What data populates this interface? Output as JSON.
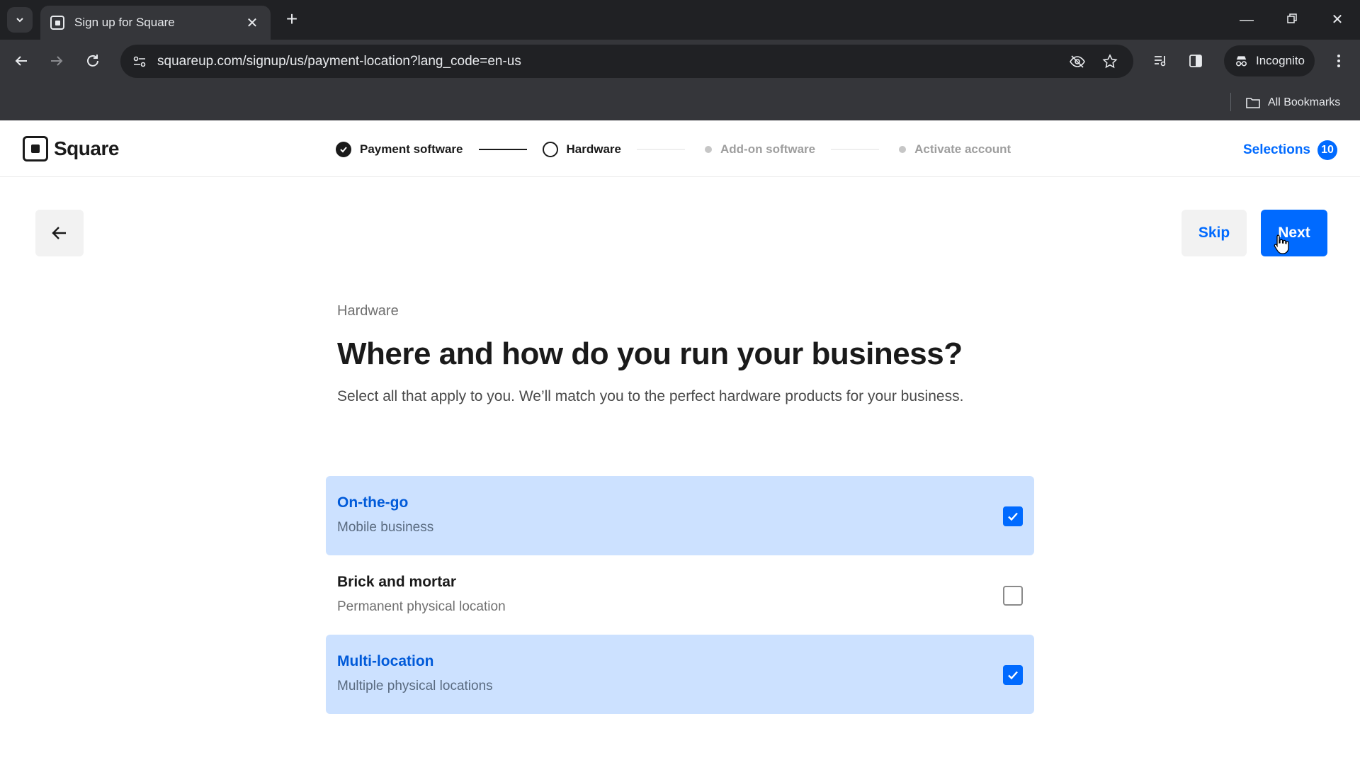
{
  "browser": {
    "tab_title": "Sign up for Square",
    "url": "squareup.com/signup/us/payment-location?lang_code=en-us",
    "incognito_label": "Incognito",
    "all_bookmarks_label": "All Bookmarks"
  },
  "header": {
    "logo_text": "Square",
    "steps": [
      {
        "label": "Payment software",
        "state": "done"
      },
      {
        "label": "Hardware",
        "state": "current"
      },
      {
        "label": "Add-on software",
        "state": "upcoming"
      },
      {
        "label": "Activate account",
        "state": "upcoming"
      }
    ],
    "selections_label": "Selections",
    "selections_count": "10"
  },
  "actions": {
    "skip_label": "Skip",
    "next_label": "Next"
  },
  "main": {
    "eyebrow": "Hardware",
    "headline": "Where and how do you run your business?",
    "subtitle": "Select all that apply to you. We’ll match you to the perfect hardware products for your business.",
    "options": [
      {
        "title": "On-the-go",
        "description": "Mobile business",
        "checked": true
      },
      {
        "title": "Brick and mortar",
        "description": "Permanent physical location",
        "checked": false
      },
      {
        "title": "Multi-location",
        "description": "Multiple physical locations",
        "checked": true
      }
    ]
  },
  "colors": {
    "brand_blue": "#006aff",
    "selected_bg": "#cce1ff"
  }
}
